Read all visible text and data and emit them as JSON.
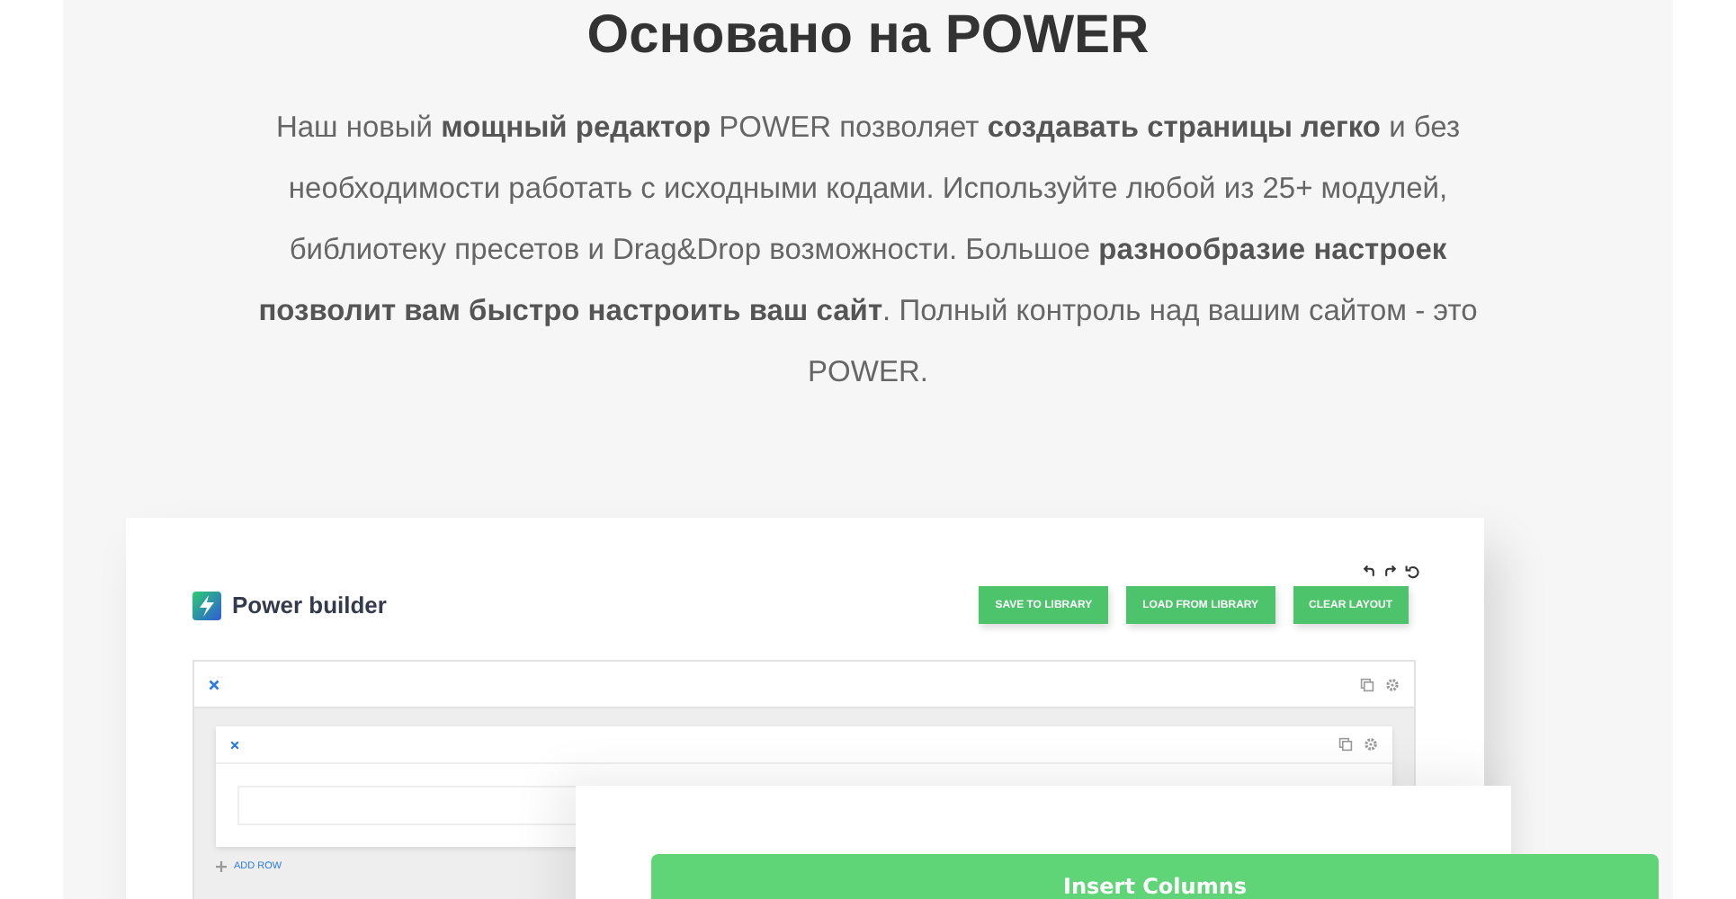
{
  "heading": "Основано на POWER",
  "intro": "Наш новый **мощный редактор** POWER позволяет **создавать страницы легко** и без необходимости работать с исходными кодами. Используйте любой из 25+ модулей, библиотеку пресетов и Drag&Drop возможности. Большое **разнообразие настроек позволит вам быстро настроить ваш сайт**. Полный контроль над вашим сайтом - это POWER.",
  "builder": {
    "brand": "Power builder",
    "buttons": [
      "SAVE TO LIBRARY",
      "LOAD FROM LIBRARY",
      "CLEAR LAYOUT"
    ],
    "add_row": "ADD ROW",
    "dialog": {
      "button": "Insert Columns"
    }
  }
}
